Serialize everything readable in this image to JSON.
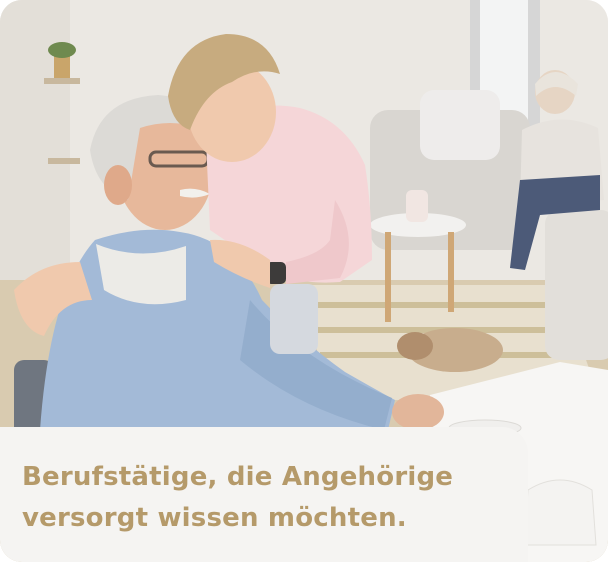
{
  "caption": {
    "line1": "Berufstätige, die Angehörige",
    "line2": "versorgt wissen möchten."
  },
  "colors": {
    "caption_text": "#b59a6a",
    "caption_background": "#f5f4f2"
  }
}
